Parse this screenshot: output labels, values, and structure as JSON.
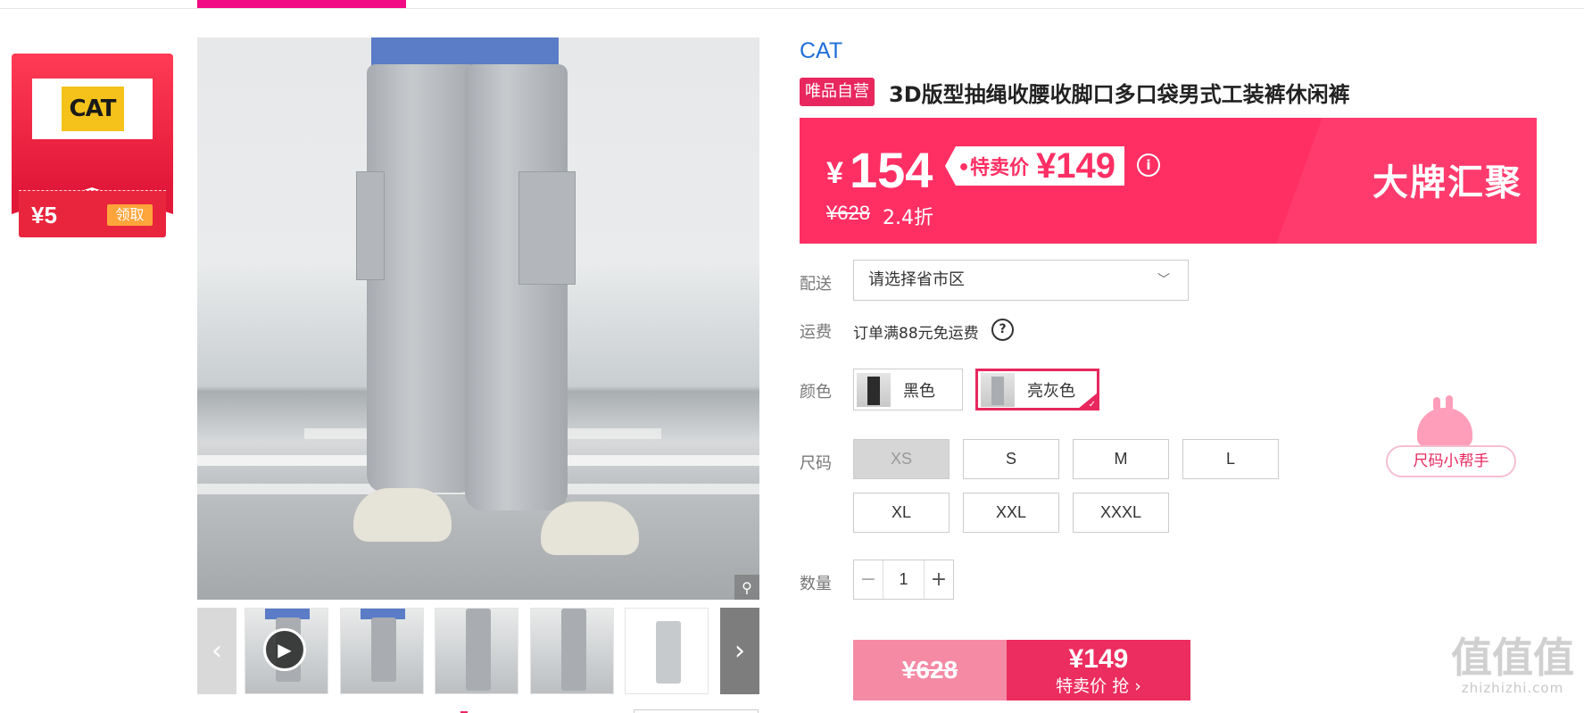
{
  "coupon": {
    "logo_text": "CAT",
    "amount": "¥5",
    "claim_label": "领取"
  },
  "product": {
    "brand": "CAT",
    "self_tag": "唯品自营",
    "title": "3D版型抽绳收腰收脚口多口袋男式工装裤休闲裤"
  },
  "price": {
    "currency": "¥",
    "current": "154",
    "special_label": "•特卖价",
    "special_price": "¥149",
    "info_icon": "i",
    "original": "¥628",
    "discount": "2.4折",
    "banner_text": "大牌汇聚"
  },
  "delivery": {
    "label": "配送",
    "placeholder": "请选择省市区",
    "chevron": "﹀"
  },
  "shipping": {
    "label": "运费",
    "text": "订单满88元免运费",
    "help_icon": "?"
  },
  "color": {
    "label": "颜色",
    "options": [
      {
        "name": "黑色",
        "selected": false
      },
      {
        "name": "亮灰色",
        "selected": true
      }
    ],
    "check": "✓"
  },
  "size": {
    "label": "尺码",
    "options": [
      "XS",
      "S",
      "M",
      "L",
      "XL",
      "XXL",
      "XXXL"
    ],
    "disabled": [
      "XS"
    ],
    "helper": "尺码小帮手"
  },
  "quantity": {
    "label": "数量",
    "minus": "−",
    "value": "1",
    "plus": "+"
  },
  "buy": {
    "original_price": "¥628",
    "price": "¥149",
    "action": "特卖价 抢 ›"
  },
  "gallery": {
    "prev": "‹",
    "next": "›",
    "play": "▶",
    "zoom": "⚲"
  },
  "watermark": {
    "logo": "值值值",
    "url": "zhizhizhi.com"
  },
  "colors": {
    "accent": "#e8275e",
    "banner": "#ff2f64",
    "brand_link": "#1e6fd9",
    "coupon": "#e21838"
  }
}
